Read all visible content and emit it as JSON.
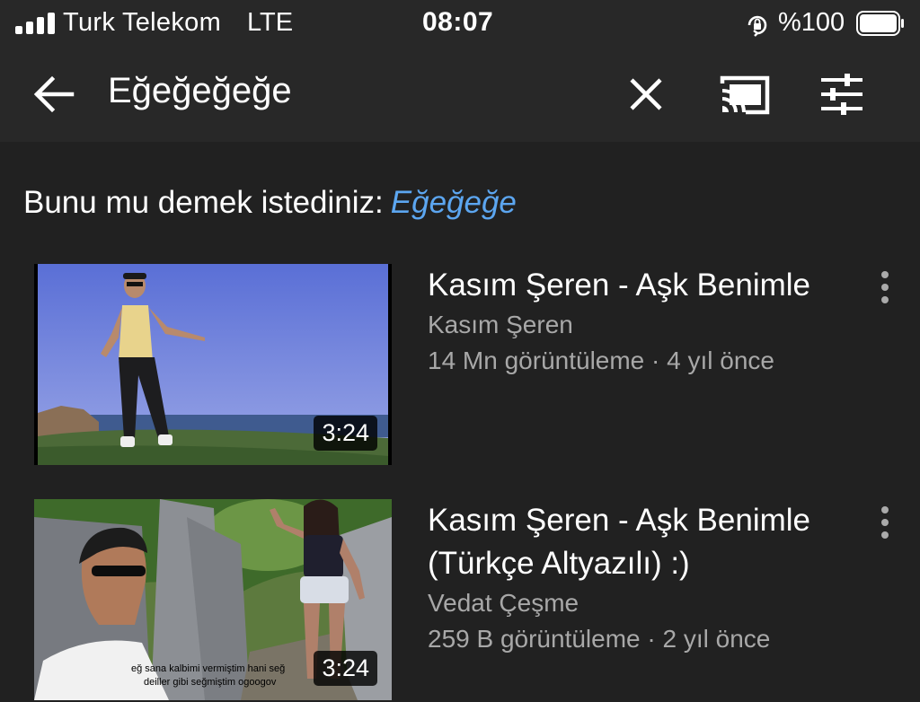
{
  "status_bar": {
    "carrier": "Turk Telekom",
    "network": "LTE",
    "time": "08:07",
    "battery": "%100",
    "icons": [
      "signal-icon",
      "rotation-lock-icon",
      "battery-icon"
    ]
  },
  "app_bar": {
    "query": "Eğeğeğeğe",
    "icons": [
      "back-arrow-icon",
      "close-icon",
      "cast-icon",
      "filter-icon"
    ]
  },
  "suggestion": {
    "prompt": "Bunu mu demek istediniz:",
    "link": "Eğeğeğe"
  },
  "results": [
    {
      "title": "Kasım Şeren - Aşk Benimle",
      "channel": "Kasım Şeren",
      "meta": "14 Mn görüntüleme · 4 yıl önce",
      "duration": "3:24"
    },
    {
      "title": "Kasım Şeren - Aşk Benimle (Türkçe Altyazılı) :)",
      "channel": "Vedat Çeşme",
      "meta": "259 B görüntüleme · 2 yıl önce",
      "duration": "3:24",
      "subtitle_lines": [
        "eğ sana kalbimi vermiştim hani seğ",
        "deiller gibi seğmiştim ogoogov"
      ]
    }
  ],
  "colors": {
    "background": "#212121",
    "bar": "#282828",
    "link": "#5ca6f0",
    "secondary_text": "#a8a8a8"
  }
}
